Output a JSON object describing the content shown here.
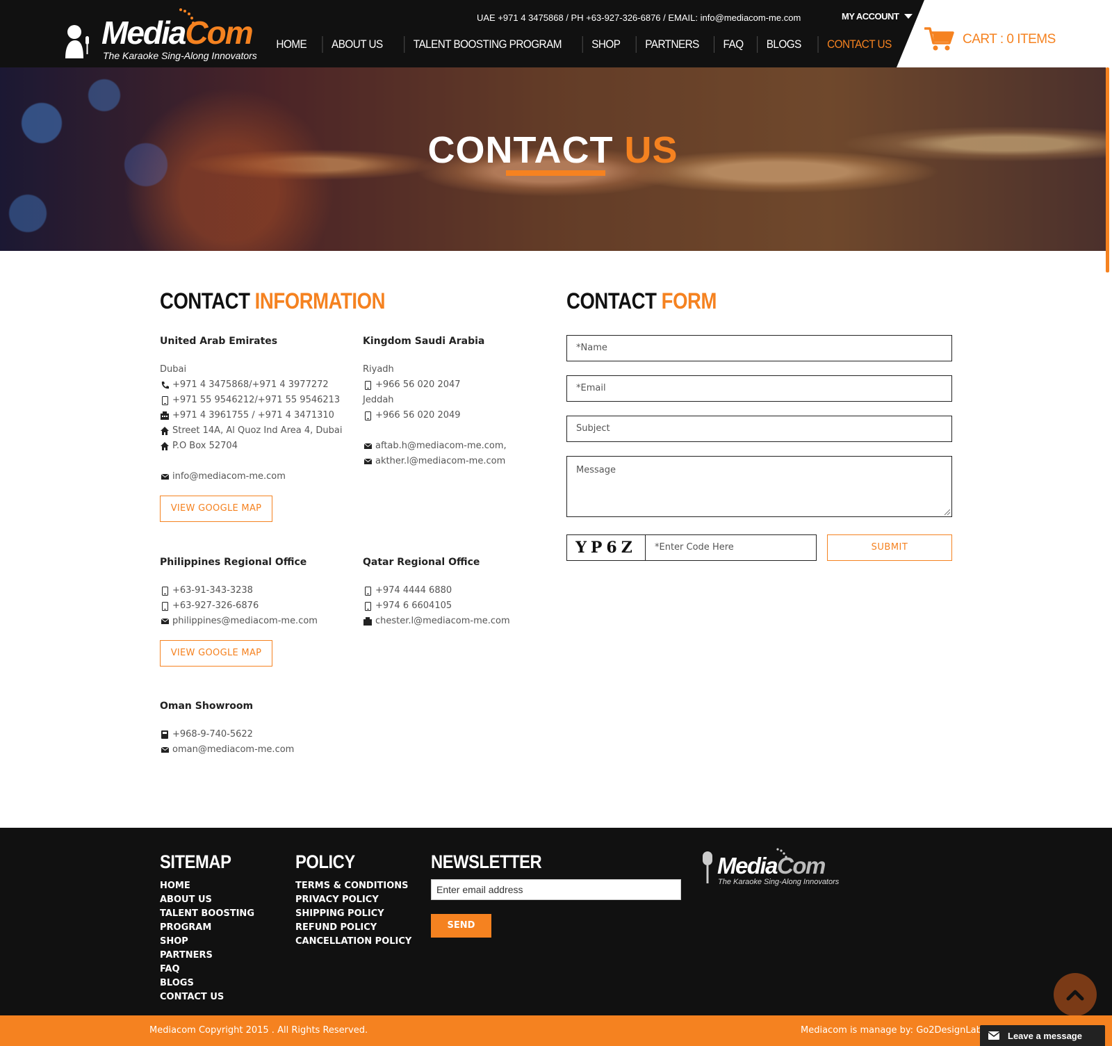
{
  "brand": {
    "name_part1": "Media",
    "name_part2": "Com",
    "tagline": "The Karaoke Sing-Along Innovators"
  },
  "header": {
    "top_info": "UAE +971 4 3475868 / PH +63-927-326-6876 / EMAIL: info@mediacom-me.com",
    "my_account": "MY ACCOUNT",
    "cart": "CART : 0 ITEMS",
    "nav": [
      "HOME",
      "ABOUT US",
      "TALENT BOOSTING PROGRAM",
      "SHOP",
      "PARTNERS",
      "FAQ",
      "BLOGS",
      "CONTACT US"
    ],
    "active_nav": "CONTACT US"
  },
  "hero": {
    "title_part1": "CONTACT",
    "title_part2": "US"
  },
  "contact_info": {
    "title_part1": "CONTACT",
    "title_part2": "INFORMATION",
    "uae": {
      "name": "United Arab Emirates",
      "city": "Dubai",
      "phone": "+971 4 3475868/+971 4 3977272",
      "mobile": "+971 55 9546212/+971 55 9546213",
      "fax": "+971 4 3961755 / +971 4 3471310",
      "address": "Street 14A, Al Quoz Ind Area 4, Dubai",
      "pobox": "P.O Box 52704",
      "email": "info@mediacom-me.com",
      "map_button": "VIEW GOOGLE MAP"
    },
    "ksa": {
      "name": "Kingdom Saudi Arabia",
      "city1": "Riyadh",
      "mobile1": "+966 56 020 2047",
      "city2": "Jeddah",
      "mobile2": "+966 56 020 2049",
      "email1": "aftab.h@mediacom-me.com,",
      "email2": "akther.l@mediacom-me.com"
    },
    "philippines": {
      "name": "Philippines Regional Office",
      "mobile1": "+63-91-343-3238",
      "mobile2": "+63-927-326-6876",
      "email": "philippines@mediacom-me.com",
      "map_button": "VIEW GOOGLE MAP"
    },
    "qatar": {
      "name": "Qatar Regional Office",
      "mobile1": "+974 4444 6880",
      "mobile2": "+974 6 6604105",
      "email": "chester.l@mediacom-me.com"
    },
    "oman": {
      "name": "Oman Showroom",
      "phone": "+968-9-740-5622",
      "email": "oman@mediacom-me.com"
    }
  },
  "contact_form": {
    "title_part1": "CONTACT",
    "title_part2": "FORM",
    "name_placeholder": "*Name",
    "email_placeholder": "*Email",
    "subject_placeholder": "Subject",
    "message_placeholder": "Message",
    "captcha_code": "YP6Z",
    "captcha_placeholder": "*Enter Code Here",
    "submit_label": "SUBMIT"
  },
  "footer": {
    "sitemap_title": "SITEMAP",
    "sitemap_links": [
      "HOME",
      "ABOUT US",
      "TALENT BOOSTING",
      "PROGRAM",
      "SHOP",
      "PARTNERS",
      "FAQ",
      "BLOGS",
      "CONTACT US"
    ],
    "policy_title": "POLICY",
    "policy_links": [
      "TERMS & CONDITIONS",
      "PRIVACY POLICY",
      "SHIPPING POLICY",
      "REFUND POLICY",
      "CANCELLATION POLICY"
    ],
    "newsletter_title": "NEWSLETTER",
    "newsletter_placeholder": "Enter email address",
    "send_label": "SEND",
    "copyright": "Mediacom Copyright 2015 . All Rights Reserved.",
    "managed_by": "Mediacom is manage by: Go2DesignLab",
    "leave_message": "Leave a message"
  },
  "colors": {
    "accent": "#f58220",
    "dark": "#111111",
    "white": "#ffffff"
  }
}
